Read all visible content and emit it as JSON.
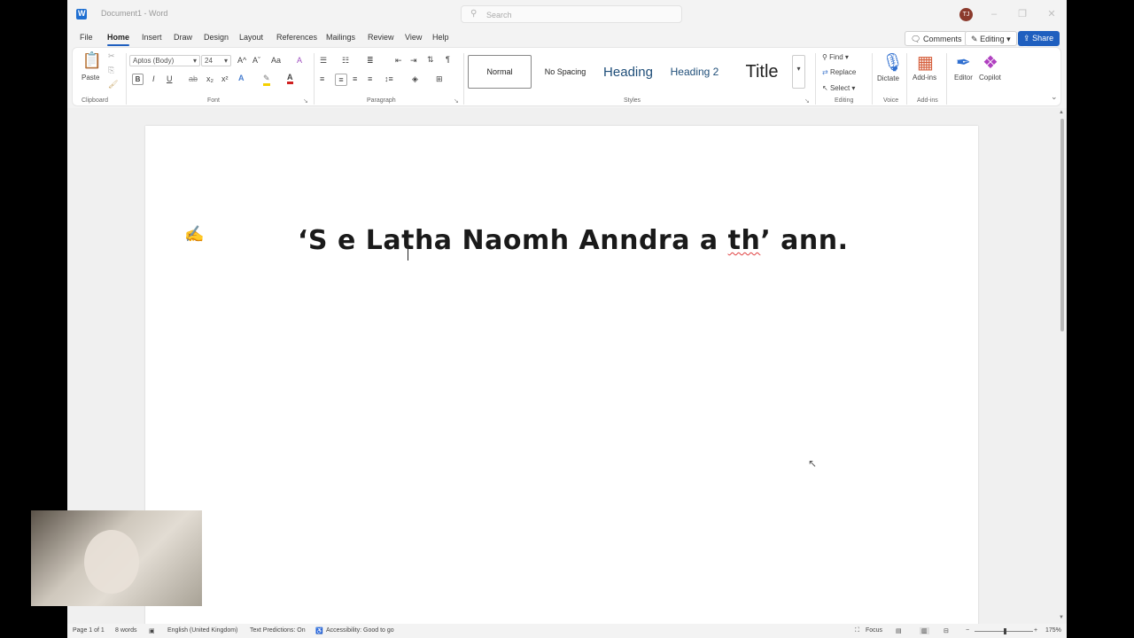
{
  "titlebar": {
    "doc_title": "Document1 - Word",
    "search_placeholder": "Search",
    "avatar_initials": "TJ"
  },
  "tabs": [
    "File",
    "Home",
    "Insert",
    "Draw",
    "Design",
    "Layout",
    "References",
    "Mailings",
    "Review",
    "View",
    "Help"
  ],
  "active_tab": "Home",
  "actions": {
    "comments": "Comments",
    "editing": "Editing",
    "share": "Share"
  },
  "ribbon": {
    "clipboard": {
      "paste": "Paste",
      "label": "Clipboard"
    },
    "font": {
      "family": "Aptos (Body)",
      "size": "24",
      "label": "Font",
      "bold": "B",
      "italic": "I",
      "underline": "U",
      "strike": "ab",
      "subscript": "x₂",
      "superscript": "x²",
      "grow": "A^",
      "shrink": "Aˇ",
      "case": "Aa",
      "clear": "A",
      "effects": "A",
      "color": "A"
    },
    "paragraph": {
      "label": "Paragraph",
      "pilcrow": "¶"
    },
    "styles": {
      "label": "Styles",
      "items": [
        "Normal",
        "No Spacing",
        "Heading",
        "Heading 2",
        "Title"
      ]
    },
    "editing": {
      "label": "Editing",
      "find": "Find",
      "replace": "Replace",
      "select": "Select"
    },
    "voice": {
      "label": "Voice",
      "dictate": "Dictate"
    },
    "addins": {
      "label": "Add-ins",
      "addins": "Add-ins",
      "editor": "Editor",
      "copilot": "Copilot"
    }
  },
  "document": {
    "before_cursor": "‘S e Lat",
    "after_cursor": "ha Naomh Anndra a ",
    "typo": "th",
    "ending": "’ ann."
  },
  "status": {
    "page": "Page 1 of 1",
    "words": "8 words",
    "language": "English (United Kingdom)",
    "predictions": "Text Predictions: On",
    "accessibility": "Accessibility: Good to go",
    "focus": "Focus",
    "zoom": "175%"
  },
  "colors": {
    "accent": "#1f5fbf",
    "highlight": "#f5d000",
    "font_color": "#d02020"
  }
}
